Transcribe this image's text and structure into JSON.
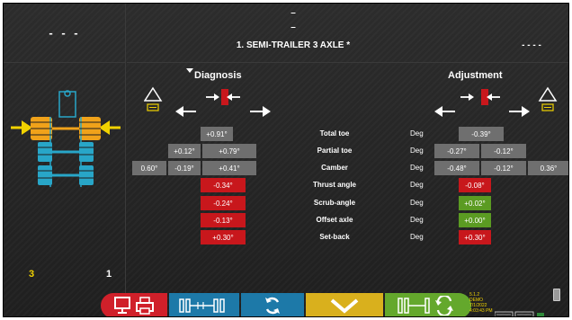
{
  "left_panel": {
    "header_dashes": "- - -",
    "axle_number": "3",
    "page_number": "1"
  },
  "header": {
    "dash_1": "–",
    "dash_2": "–",
    "vehicle_title": "1. SEMI-TRAILER 3 AXLE *",
    "right_dashes": "- - - -"
  },
  "sections": {
    "diagnosis": "Diagnosis",
    "adjustment": "Adjustment"
  },
  "table": {
    "rows": [
      {
        "label": "Total toe",
        "unit": "Deg",
        "diagnosis": {
          "left": "",
          "center": "+0.91°",
          "right": ""
        },
        "adjustment": {
          "left": "",
          "center": "-0.39°",
          "right": ""
        }
      },
      {
        "label": "Partial toe",
        "unit": "Deg",
        "diagnosis": {
          "left": "+0.12°",
          "right": "+0.79°"
        },
        "adjustment": {
          "left": "-0.27°",
          "right": "-0.12°"
        }
      },
      {
        "label": "Camber",
        "unit": "Deg",
        "diagnosis": {
          "far_left": "0.60°",
          "left": "-0.19°",
          "right": "+0.41°"
        },
        "adjustment": {
          "left": "-0.48°",
          "right": "-0.12°",
          "far_right": "0.36°"
        }
      },
      {
        "label": "Thrust angle",
        "unit": "Deg",
        "diagnosis_value": "-0.34°",
        "adjustment_value": "-0.08°"
      },
      {
        "label": "Scrub-angle",
        "unit": "Deg",
        "diagnosis_value": "-0.24°",
        "adjustment_value": "+0.02°"
      },
      {
        "label": "Offset axle",
        "unit": "Deg",
        "diagnosis_value": "-0.13°",
        "adjustment_value": "+0.00°"
      },
      {
        "label": "Set-back",
        "unit": "Deg",
        "diagnosis_value": "+0.30°",
        "adjustment_value": "+0.30°"
      }
    ],
    "status_colors": {
      "diagnosis": [
        "red",
        "red",
        "red",
        "red"
      ],
      "adjustment": [
        "red",
        "green",
        "green",
        "red"
      ]
    }
  },
  "info": {
    "version": "5.1.2",
    "mode": "DEMO",
    "date": "7/1/2022",
    "time": "4:03:43 PM"
  },
  "colors": {
    "accent_yellow": "#f1d200",
    "status_red": "#c8171c",
    "status_green": "#5b9b22",
    "value_grey": "#6f6f6f",
    "toolbar_red": "#d0202a",
    "toolbar_blue": "#1d79a8",
    "toolbar_gold": "#d9b01d",
    "toolbar_green": "#64a82c",
    "axle_blue": "#28a6c8",
    "axle_orange": "#f0a21a"
  },
  "icons": {
    "toolbar": [
      "monitor-icon",
      "printer-icon",
      "axle-adjust-icon",
      "refresh-icon",
      "chevron-down-icon",
      "axle-cycle-icon"
    ],
    "status": [
      "keyboard-icon",
      "keyboard-alt-icon",
      "network-icon",
      "battery-icon"
    ]
  }
}
